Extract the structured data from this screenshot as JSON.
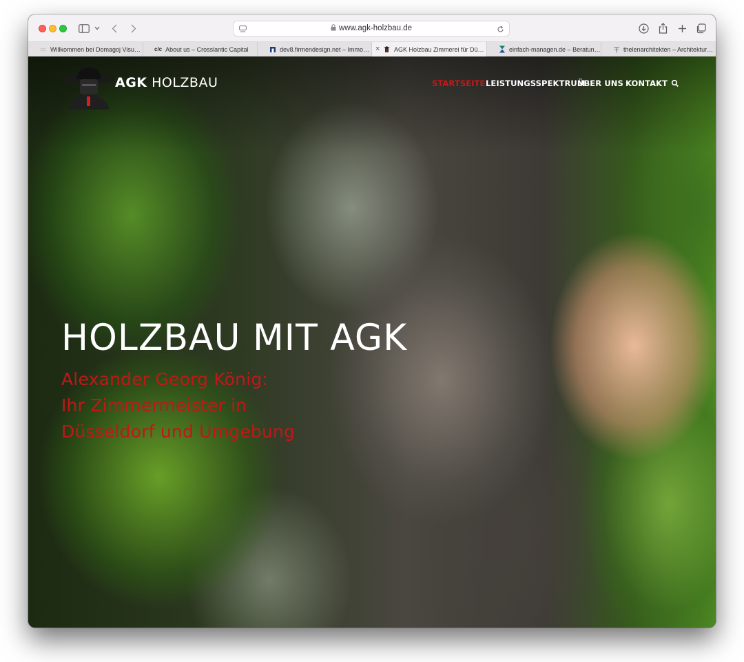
{
  "browser": {
    "url": "www.agk-holzbau.de",
    "tabs": [
      {
        "title": "Willkommen bei Domagoj Visua…",
        "favicon": "domagoj-favicon",
        "active": false
      },
      {
        "title": "About us – Crosslantic Capital",
        "favicon_text": "c/c",
        "active": false
      },
      {
        "title": "dev8.firmendesign.net – Immo…",
        "favicon": "firmendesign-favicon",
        "active": false
      },
      {
        "title": "AGK Holzbau Zimmerei für Düs…",
        "favicon": "agk-favicon",
        "active": true
      },
      {
        "title": "einfach-managen.de – Beratun…",
        "favicon": "hourglass-favicon",
        "active": false
      },
      {
        "title": "thelenarchitekten – Architektur…",
        "favicon": "thelen-favicon",
        "active": false
      }
    ]
  },
  "site": {
    "brand_bold": "AGK",
    "brand_light": "HOLZBAU",
    "nav": [
      {
        "label": "STARTSEITE",
        "active": true
      },
      {
        "label": "LEISTUNGSSPEKTRUM",
        "active": false
      },
      {
        "label": "ÜBER UNS",
        "active": false
      },
      {
        "label": "KONTAKT",
        "active": false
      }
    ],
    "accent_color": "#c41a1a"
  },
  "hero": {
    "title": "HOLZBAU MIT AGK",
    "subtitle_lines": [
      "Alexander Georg König:",
      "Ihr Zimmermeister in",
      "Düsseldorf und Umgebung"
    ]
  }
}
